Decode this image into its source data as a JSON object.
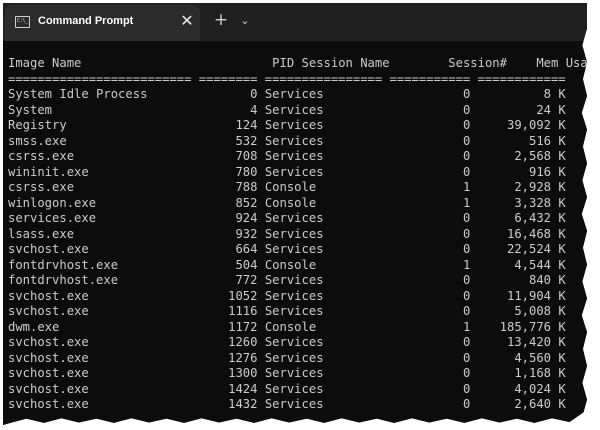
{
  "window": {
    "tab_title": "Command Prompt",
    "tab_icon_text": "C:\\_",
    "close_glyph": "✕",
    "new_tab_glyph": "+",
    "dropdown_glyph": "⌄"
  },
  "console": {
    "columns": [
      "Image Name",
      "PID",
      "Session Name",
      "Session#",
      "Mem Usage"
    ],
    "separator": "========================= ======== ================ =========== ============",
    "rows": [
      {
        "image": "System Idle Process",
        "pid": "0",
        "session_name": "Services",
        "session_num": "0",
        "mem": "8 K"
      },
      {
        "image": "System",
        "pid": "4",
        "session_name": "Services",
        "session_num": "0",
        "mem": "24 K"
      },
      {
        "image": "Registry",
        "pid": "124",
        "session_name": "Services",
        "session_num": "0",
        "mem": "39,092 K"
      },
      {
        "image": "smss.exe",
        "pid": "532",
        "session_name": "Services",
        "session_num": "0",
        "mem": "516 K"
      },
      {
        "image": "csrss.exe",
        "pid": "708",
        "session_name": "Services",
        "session_num": "0",
        "mem": "2,568 K"
      },
      {
        "image": "wininit.exe",
        "pid": "780",
        "session_name": "Services",
        "session_num": "0",
        "mem": "916 K"
      },
      {
        "image": "csrss.exe",
        "pid": "788",
        "session_name": "Console",
        "session_num": "1",
        "mem": "2,928 K"
      },
      {
        "image": "winlogon.exe",
        "pid": "852",
        "session_name": "Console",
        "session_num": "1",
        "mem": "3,328 K"
      },
      {
        "image": "services.exe",
        "pid": "924",
        "session_name": "Services",
        "session_num": "0",
        "mem": "6,432 K"
      },
      {
        "image": "lsass.exe",
        "pid": "932",
        "session_name": "Services",
        "session_num": "0",
        "mem": "16,468 K"
      },
      {
        "image": "svchost.exe",
        "pid": "664",
        "session_name": "Services",
        "session_num": "0",
        "mem": "22,524 K"
      },
      {
        "image": "fontdrvhost.exe",
        "pid": "504",
        "session_name": "Console",
        "session_num": "1",
        "mem": "4,544 K"
      },
      {
        "image": "fontdrvhost.exe",
        "pid": "772",
        "session_name": "Services",
        "session_num": "0",
        "mem": "840 K"
      },
      {
        "image": "svchost.exe",
        "pid": "1052",
        "session_name": "Services",
        "session_num": "0",
        "mem": "11,904 K"
      },
      {
        "image": "svchost.exe",
        "pid": "1116",
        "session_name": "Services",
        "session_num": "0",
        "mem": "5,008 K"
      },
      {
        "image": "dwm.exe",
        "pid": "1172",
        "session_name": "Console",
        "session_num": "1",
        "mem": "185,776 K"
      },
      {
        "image": "svchost.exe",
        "pid": "1260",
        "session_name": "Services",
        "session_num": "0",
        "mem": "13,420 K"
      },
      {
        "image": "svchost.exe",
        "pid": "1276",
        "session_name": "Services",
        "session_num": "0",
        "mem": "4,560 K"
      },
      {
        "image": "svchost.exe",
        "pid": "1300",
        "session_name": "Services",
        "session_num": "0",
        "mem": "1,168 K"
      },
      {
        "image": "svchost.exe",
        "pid": "1424",
        "session_name": "Services",
        "session_num": "0",
        "mem": "4,024 K"
      },
      {
        "image": "svchost.exe",
        "pid": "1432",
        "session_name": "Services",
        "session_num": "0",
        "mem": "2,640 K"
      }
    ]
  },
  "colors": {
    "console_bg": "#0c0c0c",
    "console_text": "#cccccc",
    "titlebar_bg": "#202020",
    "tab_bg": "#2b2b2b"
  }
}
